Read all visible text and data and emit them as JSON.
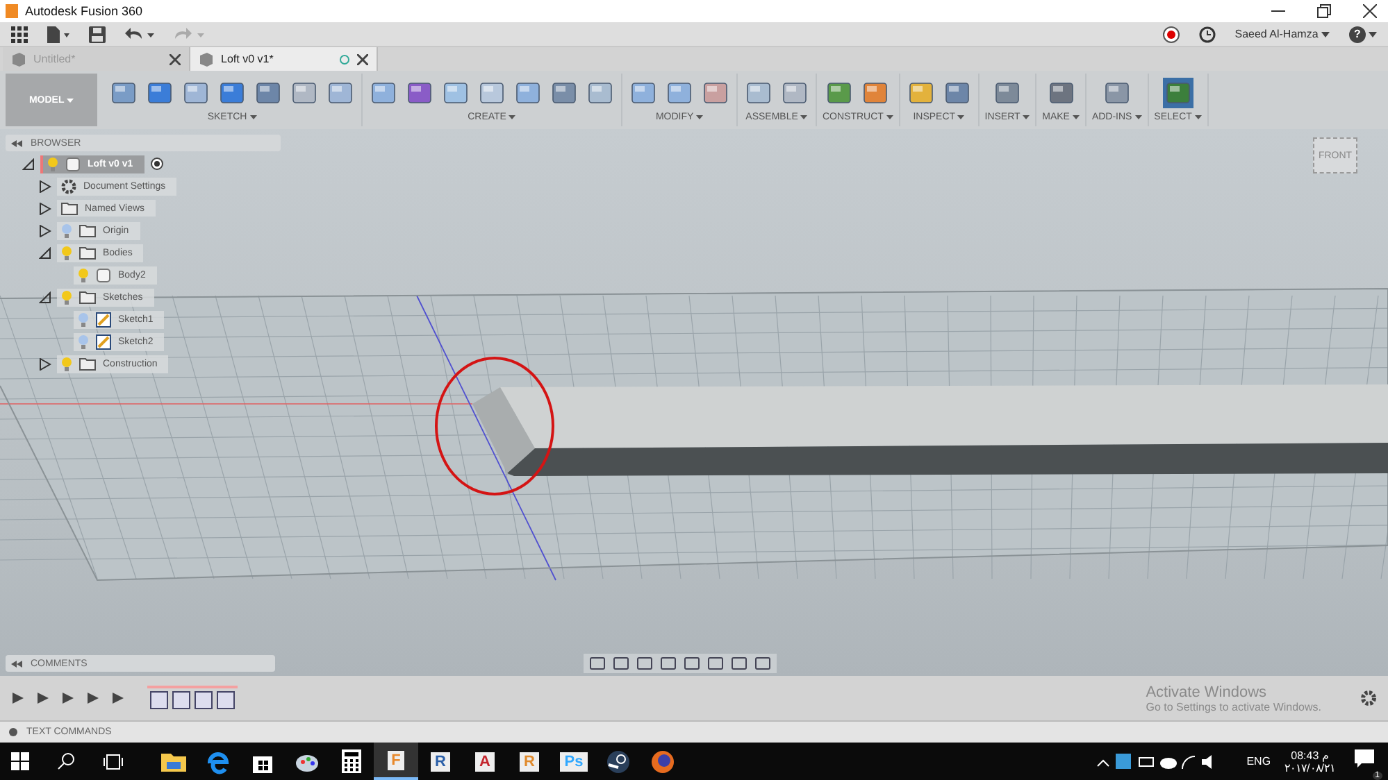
{
  "window": {
    "title": "Autodesk Fusion 360"
  },
  "app_bar": {
    "user": "Saeed Al-Hamza",
    "help": "?"
  },
  "tabs": [
    {
      "label": "Untitled*",
      "selected": false
    },
    {
      "label": "Loft v0 v1*",
      "selected": true
    }
  ],
  "ribbon": {
    "workspace": "MODEL",
    "groups": [
      {
        "label": "SKETCH"
      },
      {
        "label": "CREATE"
      },
      {
        "label": "MODIFY"
      },
      {
        "label": "ASSEMBLE"
      },
      {
        "label": "CONSTRUCT"
      },
      {
        "label": "INSPECT"
      },
      {
        "label": "INSERT"
      },
      {
        "label": "MAKE"
      },
      {
        "label": "ADD-INS"
      },
      {
        "label": "SELECT"
      }
    ]
  },
  "browser": {
    "title": "BROWSER",
    "root": {
      "label": "Loft v0 v1",
      "kind": "component",
      "visible": true,
      "expanded": true,
      "children": [
        {
          "label": "Document Settings",
          "kind": "gear",
          "expanded": false
        },
        {
          "label": "Named Views",
          "kind": "folder",
          "expanded": false
        },
        {
          "label": "Origin",
          "kind": "folder",
          "visible": false,
          "expanded": false
        },
        {
          "label": "Bodies",
          "kind": "folder",
          "visible": true,
          "expanded": true,
          "children": [
            {
              "label": "Body2",
              "kind": "body",
              "visible": true
            }
          ]
        },
        {
          "label": "Sketches",
          "kind": "folder",
          "visible": true,
          "expanded": true,
          "children": [
            {
              "label": "Sketch1",
              "kind": "sketch",
              "visible": false
            },
            {
              "label": "Sketch2",
              "kind": "sketch",
              "visible": false
            }
          ]
        },
        {
          "label": "Construction",
          "kind": "folder",
          "visible": true,
          "expanded": false
        }
      ]
    }
  },
  "view_cube": {
    "face": "FRONT"
  },
  "comments": {
    "title": "COMMENTS"
  },
  "text_commands": {
    "title": "TEXT COMMANDS"
  },
  "activation_notice": {
    "title": "Activate Windows",
    "text": "Go to Settings to activate Windows."
  },
  "taskbar": {
    "apps": [
      {
        "kind": "folder",
        "selected": false
      },
      {
        "kind": "edge",
        "selected": false
      },
      {
        "kind": "store",
        "selected": false
      },
      {
        "kind": "paint",
        "selected": false
      },
      {
        "kind": "calculator",
        "selected": false
      },
      {
        "kind": "letter",
        "glyph": "F",
        "color": "#e8892c",
        "selected": true
      },
      {
        "kind": "letter",
        "glyph": "R",
        "color": "#2a5fa8",
        "selected": false
      },
      {
        "kind": "letter",
        "glyph": "A",
        "color": "#c4262e",
        "selected": false
      },
      {
        "kind": "letter",
        "glyph": "R",
        "color": "#e08a2c",
        "selected": false
      },
      {
        "kind": "letter",
        "glyph": "Ps",
        "color": "#31a8ff",
        "selected": false
      },
      {
        "kind": "steam",
        "selected": false
      },
      {
        "kind": "firefox",
        "selected": false
      }
    ],
    "language": "ENG",
    "time": "08:43 م",
    "date": "٢٠١٧/٠٨/٢١",
    "notifications": "1"
  }
}
